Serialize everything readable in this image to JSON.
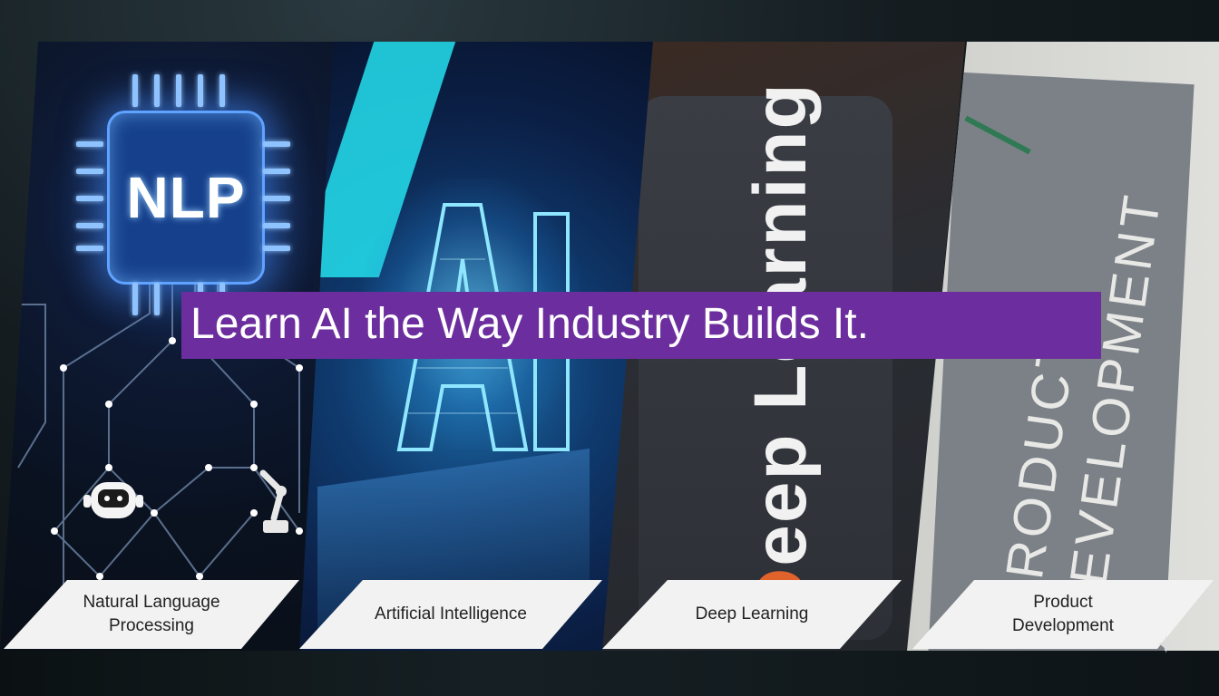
{
  "headline": "Learn AI the Way Industry Builds It.",
  "panels": [
    {
      "label": "Natural Language\nProcessing",
      "label_line1": "Natural Language",
      "label_line2": "Processing",
      "graphic_text": "NLP"
    },
    {
      "label": "Artificial Intelligence",
      "graphic_text": "AI"
    },
    {
      "label": "Deep Learning",
      "graphic_text_a": "D",
      "graphic_text_b": "eep Learning"
    },
    {
      "label": "Product\nDevelopment",
      "label_line1": "Product",
      "label_line2": "Development",
      "graphic_line1": "PRODUCT",
      "graphic_line2": "DEVELOPMENT"
    }
  ],
  "colors": {
    "banner": "#6c2e9e",
    "label_bg": "#f2f2f2",
    "accent_cyan": "#22d6e6",
    "accent_orange": "#e2622b"
  },
  "icons": [
    "robot-icon",
    "robotic-arm-icon",
    "cloud-icon",
    "sparkle-icon"
  ]
}
